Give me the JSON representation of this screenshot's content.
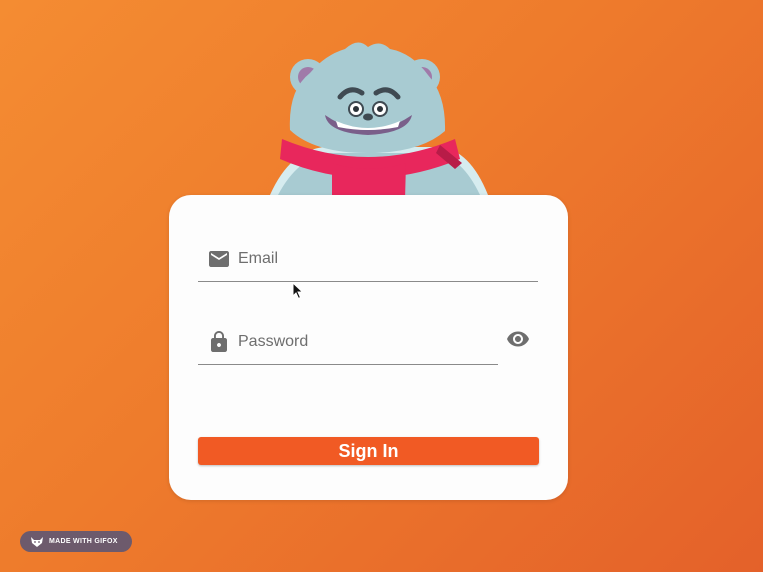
{
  "colors": {
    "background_start": "#f48c32",
    "background_end": "#e4612a",
    "card": "#fdfdfd",
    "accent": "#f15a24",
    "icon": "#6e6e6e",
    "badge": "#6d5a6c"
  },
  "mascot": {
    "name": "yeti-mascot-with-scarf"
  },
  "login": {
    "email": {
      "placeholder": "Email",
      "value": "",
      "icon": "mail-icon"
    },
    "password": {
      "placeholder": "Password",
      "value": "",
      "icon": "lock-icon",
      "toggle_icon": "eye-icon"
    },
    "submit_label": "Sign In"
  },
  "badge": {
    "text": "MADE WITH GIFOX",
    "icon": "fox-icon"
  }
}
